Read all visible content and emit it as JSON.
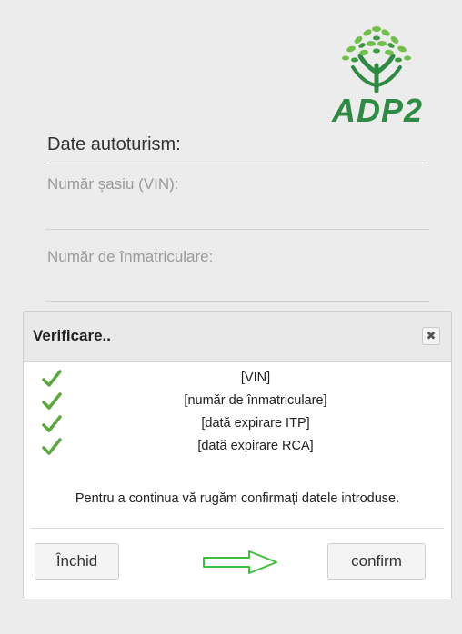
{
  "logo": {
    "text": "ADP2",
    "brand_color": "#2f8a43"
  },
  "form": {
    "section_title": "Date autoturism:",
    "vin_label": "Număr șasiu (VIN):",
    "plate_label": "Număr de înmatriculare:"
  },
  "modal": {
    "title": "Verificare..",
    "close_symbol": "✖",
    "checks": [
      {
        "icon": "check-icon",
        "label": "[VIN]"
      },
      {
        "icon": "check-icon",
        "label": "[număr de înmatriculare]"
      },
      {
        "icon": "check-icon",
        "label": "[dată expirare ITP]"
      },
      {
        "icon": "check-icon",
        "label": "[dată expirare RCA]"
      }
    ],
    "message": "Pentru a continua vă rugăm confirmați datele introduse.",
    "close_button": "Închid",
    "confirm_button": "confirm",
    "arrow_icon": "right-arrow-icon"
  }
}
